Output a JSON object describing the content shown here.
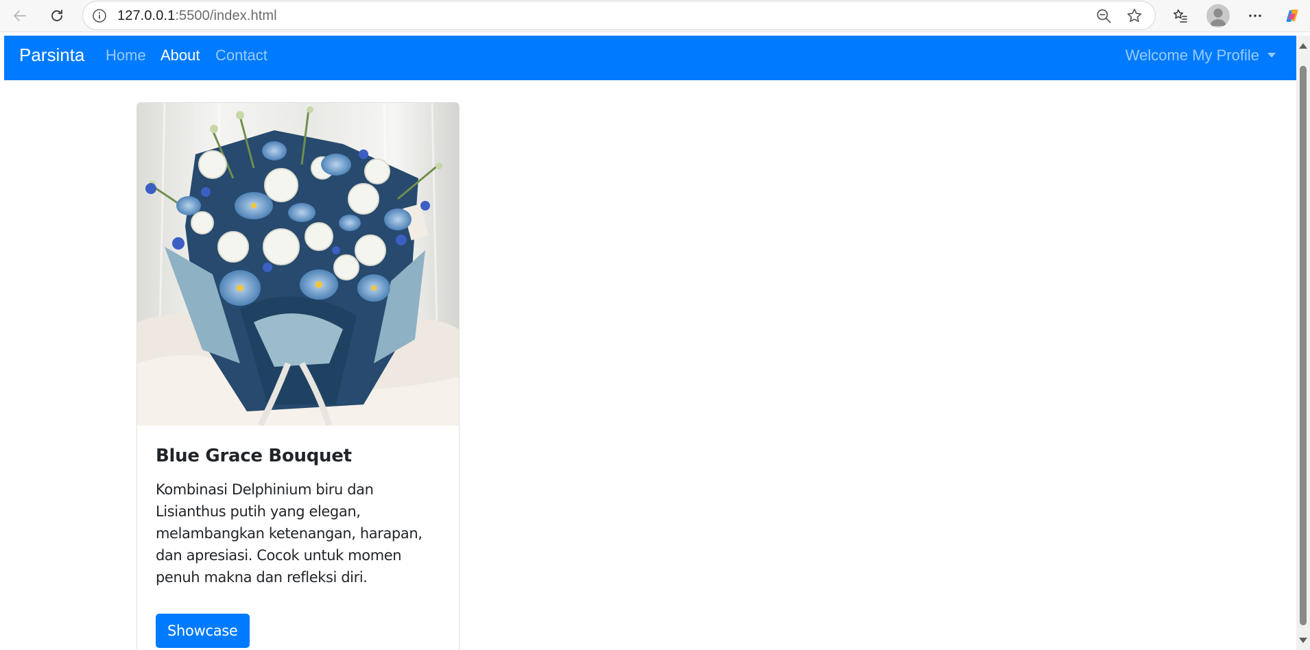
{
  "browser": {
    "url_host": "127.0.0.1",
    "url_rest": ":5500/index.html"
  },
  "navbar": {
    "brand": "Parsinta",
    "links": [
      {
        "label": "Home",
        "active": false
      },
      {
        "label": "About",
        "active": true
      },
      {
        "label": "Contact",
        "active": false
      }
    ],
    "profile": "Welcome My Profile"
  },
  "card": {
    "image_alt": "Blue bouquet of flowers",
    "title": "Blue Grace Bouquet",
    "text": "Kombinasi Delphinium biru dan Lisianthus putih yang elegan, melambangkan ketenangan, harapan, dan apresiasi. Cocok untuk momen penuh makna dan refleksi diri.",
    "button": "Showcase"
  },
  "colors": {
    "navbar_bg": "#007bff",
    "button_bg": "#007bff",
    "text": "#212529"
  }
}
